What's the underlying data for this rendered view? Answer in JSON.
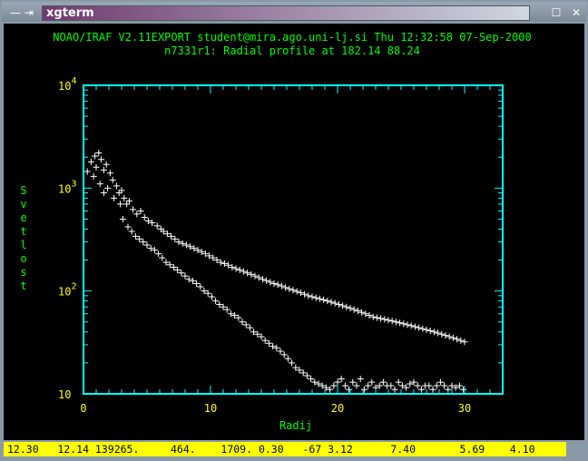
{
  "window": {
    "title": "xgterm",
    "menu_glyph": "— ⇥",
    "minimize_glyph": "☐",
    "maximize_glyph": "✕"
  },
  "plot": {
    "header_line1": "NOAO/IRAF V2.11EXPORT student@mira.ago.uni-lj.si Thu 12:32:58 07-Sep-2000",
    "header_line2": "n7331r1: Radial profile at 182.14 88.24",
    "xlabel": "Radij",
    "ylabel": "Svetlost",
    "x_ticks": [
      "0",
      "10",
      "20",
      "30"
    ],
    "y_ticks": [
      {
        "base": "10",
        "exp": "4"
      },
      {
        "base": "10",
        "exp": "3"
      },
      {
        "base": "10",
        "exp": "2"
      },
      {
        "base": "10",
        "exp": ""
      }
    ]
  },
  "status": {
    "text": "12.30   12.14 139265.     464.    1709. 0.30   -67 3.12      7.40       5.69    4.10"
  },
  "colors": {
    "axis": "#00ffff",
    "tick_labels": "#ffff00",
    "titles": "#00ff00",
    "points": "#ffffff",
    "status_bg": "#ffff00"
  },
  "chart_data": {
    "type": "scatter",
    "title": "n7331r1: Radial profile at 182.14 88.24",
    "xlabel": "Radij",
    "ylabel": "Svetlost",
    "xlim": [
      0,
      33
    ],
    "ylim": [
      10,
      10000
    ],
    "y_scale": "log",
    "grid": false,
    "legend": "none",
    "series": [
      {
        "marker": "+",
        "points": [
          [
            0.3,
            1450
          ],
          [
            0.6,
            1800
          ],
          [
            0.9,
            2050
          ],
          [
            1.2,
            2200
          ],
          [
            1.0,
            1600
          ],
          [
            0.8,
            1300
          ],
          [
            1.4,
            1900
          ],
          [
            1.6,
            1500
          ],
          [
            1.8,
            1700
          ],
          [
            2.1,
            1400
          ],
          [
            1.3,
            1100
          ],
          [
            1.6,
            900
          ],
          [
            1.9,
            1000
          ],
          [
            2.3,
            1200
          ],
          [
            2.6,
            1050
          ],
          [
            2.4,
            800
          ],
          [
            2.8,
            900
          ],
          [
            3.0,
            950
          ],
          [
            3.2,
            800
          ],
          [
            2.9,
            700
          ],
          [
            3.4,
            700
          ],
          [
            3.6,
            750
          ],
          [
            3.9,
            620
          ],
          [
            4.2,
            560
          ],
          [
            4.5,
            600
          ],
          [
            4.8,
            520
          ],
          [
            5.1,
            480
          ],
          [
            5.4,
            460
          ],
          [
            5.8,
            430
          ],
          [
            6.1,
            400
          ],
          [
            3.1,
            500
          ],
          [
            3.5,
            420
          ],
          [
            3.8,
            380
          ],
          [
            4.1,
            340
          ],
          [
            4.4,
            320
          ],
          [
            4.7,
            300
          ],
          [
            5.0,
            280
          ],
          [
            5.3,
            260
          ],
          [
            5.6,
            250
          ],
          [
            5.9,
            230
          ],
          [
            6.3,
            380
          ],
          [
            6.6,
            360
          ],
          [
            6.9,
            340
          ],
          [
            7.2,
            320
          ],
          [
            7.5,
            300
          ],
          [
            7.8,
            290
          ],
          [
            8.1,
            280
          ],
          [
            8.4,
            270
          ],
          [
            8.7,
            260
          ],
          [
            9.0,
            250
          ],
          [
            6.2,
            210
          ],
          [
            6.5,
            190
          ],
          [
            6.8,
            180
          ],
          [
            7.1,
            170
          ],
          [
            7.4,
            160
          ],
          [
            7.7,
            150
          ],
          [
            8.0,
            140
          ],
          [
            8.3,
            130
          ],
          [
            8.6,
            125
          ],
          [
            8.9,
            118
          ],
          [
            9.3,
            240
          ],
          [
            9.6,
            230
          ],
          [
            9.9,
            220
          ],
          [
            10.2,
            210
          ],
          [
            10.5,
            200
          ],
          [
            10.8,
            190
          ],
          [
            11.1,
            185
          ],
          [
            11.4,
            178
          ],
          [
            11.7,
            170
          ],
          [
            12.0,
            165
          ],
          [
            9.2,
            110
          ],
          [
            9.5,
            100
          ],
          [
            9.8,
            95
          ],
          [
            10.1,
            88
          ],
          [
            10.4,
            80
          ],
          [
            10.7,
            74
          ],
          [
            11.0,
            70
          ],
          [
            11.3,
            66
          ],
          [
            11.6,
            60
          ],
          [
            11.9,
            58
          ],
          [
            12.3,
            160
          ],
          [
            12.6,
            155
          ],
          [
            12.9,
            150
          ],
          [
            13.2,
            145
          ],
          [
            13.5,
            140
          ],
          [
            13.8,
            135
          ],
          [
            14.1,
            130
          ],
          [
            14.4,
            126
          ],
          [
            14.7,
            122
          ],
          [
            15.0,
            118
          ],
          [
            12.2,
            55
          ],
          [
            12.5,
            50
          ],
          [
            12.8,
            47
          ],
          [
            13.1,
            44
          ],
          [
            13.4,
            40
          ],
          [
            13.7,
            38
          ],
          [
            14.0,
            36
          ],
          [
            14.3,
            33
          ],
          [
            14.6,
            31
          ],
          [
            14.9,
            29
          ],
          [
            15.3,
            115
          ],
          [
            15.6,
            112
          ],
          [
            15.9,
            108
          ],
          [
            16.2,
            105
          ],
          [
            16.5,
            102
          ],
          [
            16.8,
            99
          ],
          [
            17.1,
            96
          ],
          [
            17.4,
            93
          ],
          [
            17.7,
            90
          ],
          [
            18.0,
            88
          ],
          [
            15.2,
            28
          ],
          [
            15.5,
            26
          ],
          [
            15.8,
            24
          ],
          [
            16.1,
            22
          ],
          [
            16.4,
            20
          ],
          [
            16.7,
            18
          ],
          [
            17.0,
            17
          ],
          [
            17.3,
            16
          ],
          [
            17.6,
            15
          ],
          [
            17.9,
            14
          ],
          [
            18.3,
            86
          ],
          [
            18.6,
            84
          ],
          [
            18.9,
            82
          ],
          [
            19.2,
            80
          ],
          [
            19.5,
            78
          ],
          [
            19.8,
            76
          ],
          [
            20.1,
            74
          ],
          [
            20.4,
            72
          ],
          [
            20.7,
            70
          ],
          [
            21.0,
            68
          ],
          [
            18.2,
            13
          ],
          [
            18.5,
            12.5
          ],
          [
            18.8,
            12
          ],
          [
            19.1,
            11.5
          ],
          [
            19.4,
            11
          ],
          [
            19.7,
            12
          ],
          [
            20.0,
            13
          ],
          [
            20.3,
            14
          ],
          [
            20.6,
            12
          ],
          [
            20.9,
            11
          ],
          [
            21.3,
            66
          ],
          [
            21.6,
            64
          ],
          [
            21.9,
            62
          ],
          [
            22.2,
            60
          ],
          [
            22.5,
            58
          ],
          [
            22.8,
            56
          ],
          [
            23.1,
            55
          ],
          [
            23.4,
            54
          ],
          [
            23.7,
            53
          ],
          [
            24.0,
            52
          ],
          [
            21.2,
            13
          ],
          [
            21.5,
            12
          ],
          [
            21.8,
            14
          ],
          [
            22.1,
            11
          ],
          [
            22.4,
            12
          ],
          [
            22.7,
            13
          ],
          [
            23.0,
            11.5
          ],
          [
            23.3,
            12
          ],
          [
            23.6,
            13
          ],
          [
            23.9,
            12
          ],
          [
            24.3,
            51
          ],
          [
            24.6,
            50
          ],
          [
            24.9,
            49
          ],
          [
            25.2,
            48
          ],
          [
            25.5,
            47
          ],
          [
            25.8,
            46
          ],
          [
            26.1,
            45
          ],
          [
            26.4,
            44
          ],
          [
            26.7,
            43
          ],
          [
            27.0,
            42
          ],
          [
            24.2,
            12
          ],
          [
            24.5,
            11
          ],
          [
            24.8,
            13
          ],
          [
            25.1,
            12
          ],
          [
            25.4,
            11.5
          ],
          [
            25.7,
            12.5
          ],
          [
            26.0,
            13
          ],
          [
            26.3,
            12
          ],
          [
            26.6,
            11
          ],
          [
            26.9,
            12
          ],
          [
            27.3,
            41
          ],
          [
            27.6,
            40
          ],
          [
            27.9,
            39
          ],
          [
            28.2,
            38
          ],
          [
            28.5,
            37
          ],
          [
            28.8,
            36
          ],
          [
            29.1,
            35
          ],
          [
            29.4,
            34
          ],
          [
            29.7,
            33
          ],
          [
            30.0,
            32
          ],
          [
            27.2,
            12
          ],
          [
            27.5,
            11
          ],
          [
            27.8,
            12
          ],
          [
            28.1,
            13
          ],
          [
            28.4,
            12
          ],
          [
            28.7,
            11
          ],
          [
            29.0,
            12
          ],
          [
            29.3,
            11.5
          ],
          [
            29.6,
            12
          ],
          [
            29.9,
            11
          ]
        ]
      }
    ]
  }
}
